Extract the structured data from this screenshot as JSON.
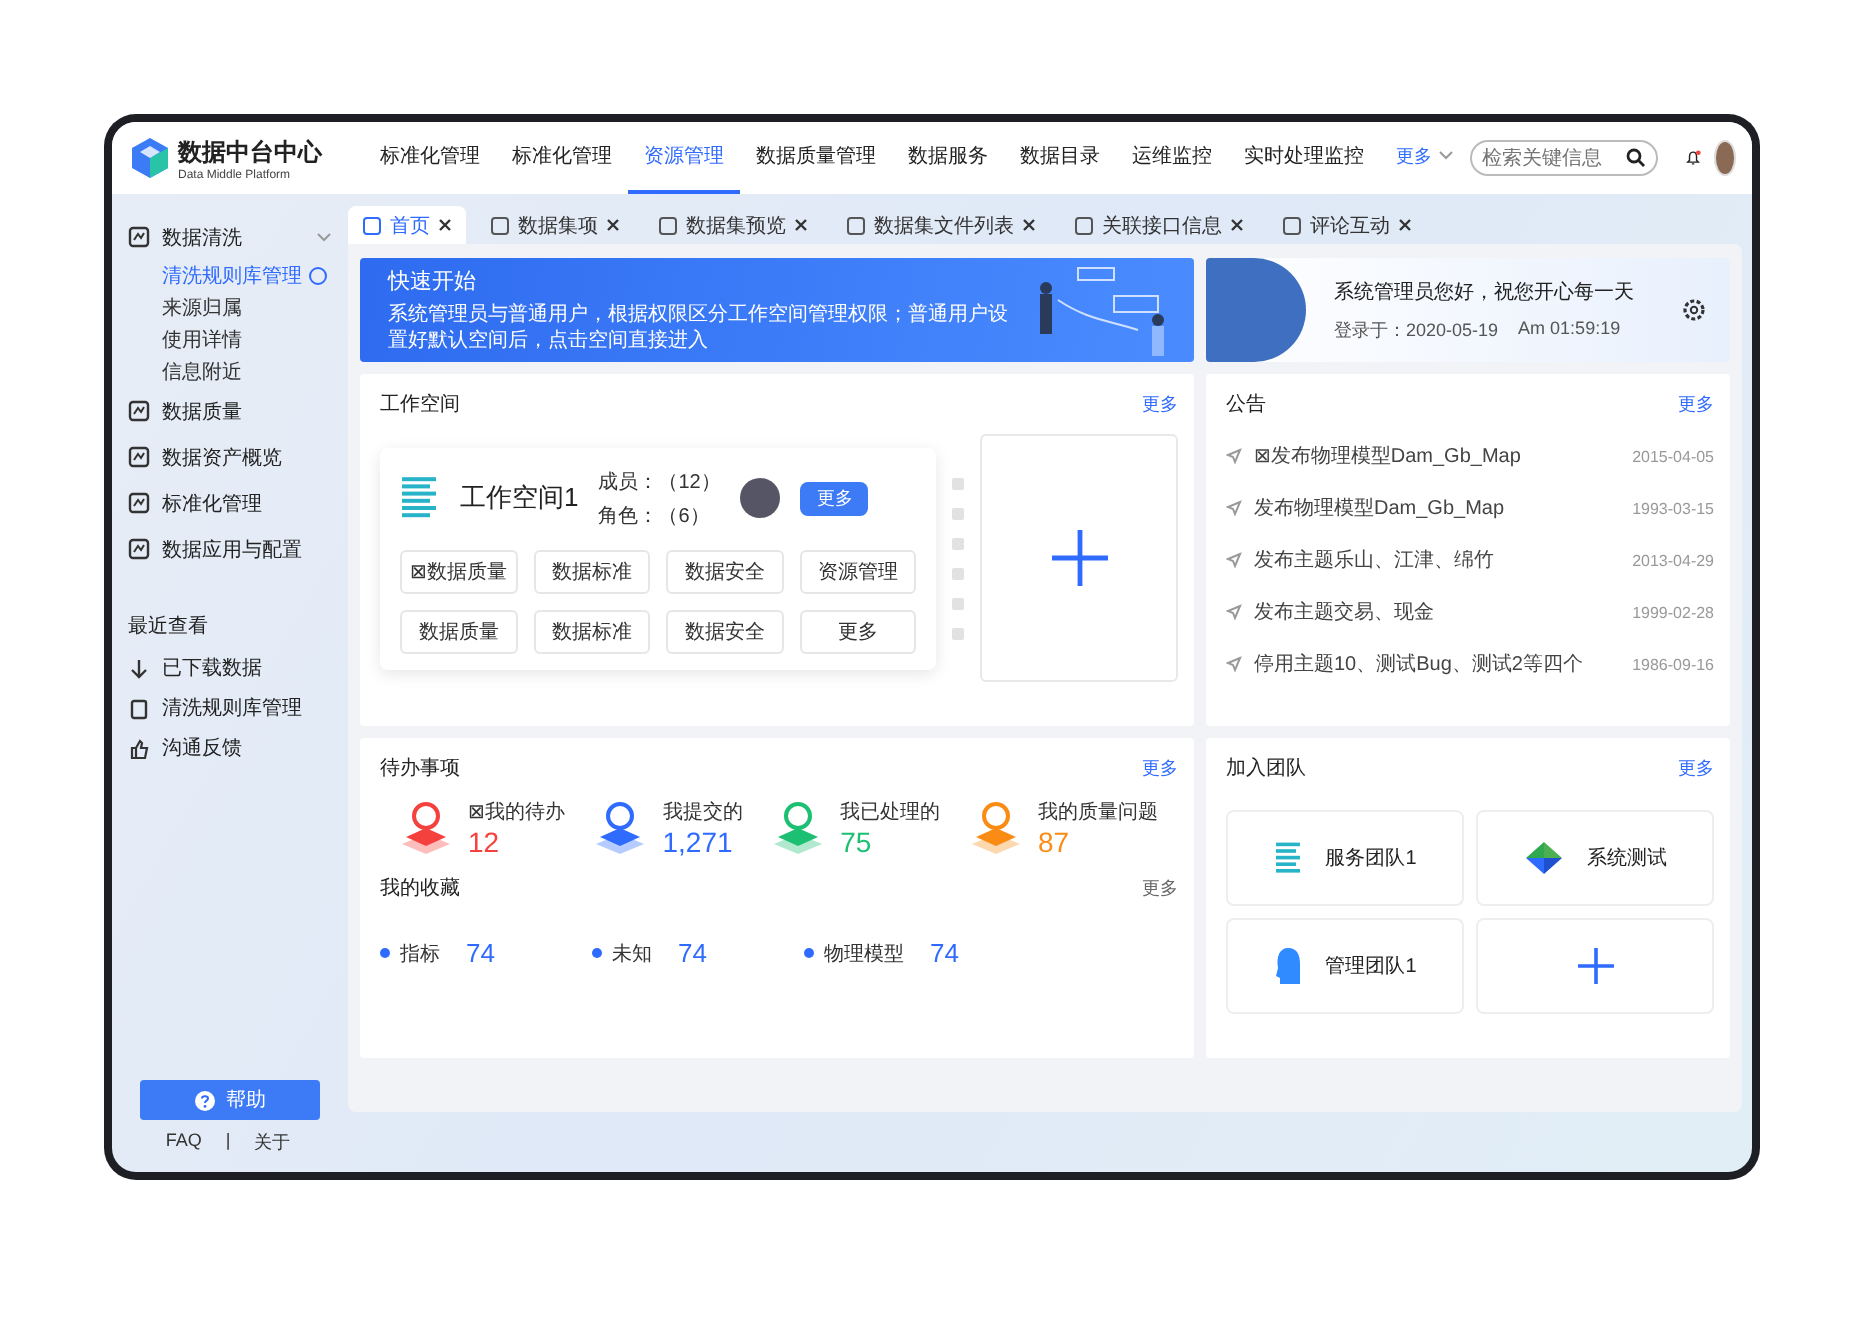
{
  "header": {
    "title": "数据中台中心",
    "subtitle": "Data Middle Platform",
    "nav": [
      {
        "label": "标准化管理",
        "selected": false
      },
      {
        "label": "标准化管理",
        "selected": false
      },
      {
        "label": "资源管理",
        "selected": true
      },
      {
        "label": "数据质量管理",
        "selected": false
      },
      {
        "label": "数据服务",
        "selected": false
      },
      {
        "label": "数据目录",
        "selected": false
      },
      {
        "label": "运维监控",
        "selected": false
      },
      {
        "label": "实时处理监控",
        "selected": false
      }
    ],
    "more": "更多",
    "search": {
      "placeholder": "检索关键信息"
    }
  },
  "sidebar": {
    "items": [
      {
        "label": "数据清洗",
        "expanded": true,
        "children": [
          {
            "label": "清洗规则库管理",
            "selected": true
          },
          {
            "label": "来源归属",
            "selected": false
          },
          {
            "label": "使用详情",
            "selected": false
          },
          {
            "label": "信息附近",
            "selected": false
          }
        ]
      },
      {
        "label": "数据质量"
      },
      {
        "label": "数据资产概览"
      },
      {
        "label": "标准化管理"
      },
      {
        "label": "数据应用与配置"
      }
    ],
    "recent_title": "最近查看",
    "recent": [
      "已下载数据",
      "清洗规则库管理",
      "沟通反馈"
    ],
    "help": "帮助",
    "links": [
      "FAQ",
      "关于"
    ],
    "separator": "|"
  },
  "tabs": [
    {
      "label": "首页",
      "selected": true
    },
    {
      "label": "数据集项",
      "selected": false
    },
    {
      "label": "数据集预览",
      "selected": false
    },
    {
      "label": "数据集文件列表",
      "selected": false
    },
    {
      "label": "关联接口信息",
      "selected": false
    },
    {
      "label": "评论互动",
      "selected": false
    }
  ],
  "banner": {
    "title": "快速开始",
    "text": "系统管理员与普通用户，根据权限区分工作空间管理权限；普通用户设置好默认空间后，点击空间直接进入"
  },
  "welcome": {
    "greeting": "系统管理员您好，祝您开心每一天",
    "login": "登录于：2020-05-19",
    "time": "Am 01:59:19"
  },
  "workspace": {
    "title": "工作空间",
    "more": "更多",
    "name": "工作空间1",
    "members": "成员：（12）",
    "roles": "角色：（6）",
    "action": "更多",
    "buttons": [
      "⊠数据质量",
      "数据标准",
      "数据安全",
      "资源管理",
      "数据质量",
      "数据标准",
      "数据安全",
      "更多"
    ]
  },
  "notices": {
    "title": "公告",
    "more": "更多",
    "items": [
      {
        "text": "⊠发布物理模型Dam_Gb_Map",
        "date": "2015-04-05"
      },
      {
        "text": "发布物理模型Dam_Gb_Map",
        "date": "1993-03-15"
      },
      {
        "text": "发布主题乐山、江津、绵竹",
        "date": "2013-04-29"
      },
      {
        "text": "发布主题交易、现金",
        "date": "1999-02-28"
      },
      {
        "text": "停用主题10、测试Bug、测试2等四个",
        "date": "1986-09-16"
      }
    ]
  },
  "todo": {
    "title": "待办事项",
    "more": "更多",
    "items": [
      {
        "label": "⊠我的待办",
        "count": "12",
        "color": "#f5413d"
      },
      {
        "label": "我提交的",
        "count": "1,271",
        "color": "#2f6bff"
      },
      {
        "label": "我已处理的",
        "count": "75",
        "color": "#1dbf73"
      },
      {
        "label": "我的质量问题",
        "count": "87",
        "color": "#fa8c16"
      }
    ]
  },
  "favorites": {
    "title": "我的收藏",
    "more": "更多",
    "items": [
      {
        "label": "指标",
        "count": "74"
      },
      {
        "label": "未知",
        "count": "74"
      },
      {
        "label": "物理模型",
        "count": "74"
      }
    ]
  },
  "teams": {
    "title": "加入团队",
    "more": "更多",
    "items": [
      {
        "kind": "team",
        "name": "服务团队1"
      },
      {
        "kind": "team",
        "name": "系统测试"
      },
      {
        "kind": "team",
        "name": "管理团队1"
      },
      {
        "kind": "add"
      }
    ]
  }
}
